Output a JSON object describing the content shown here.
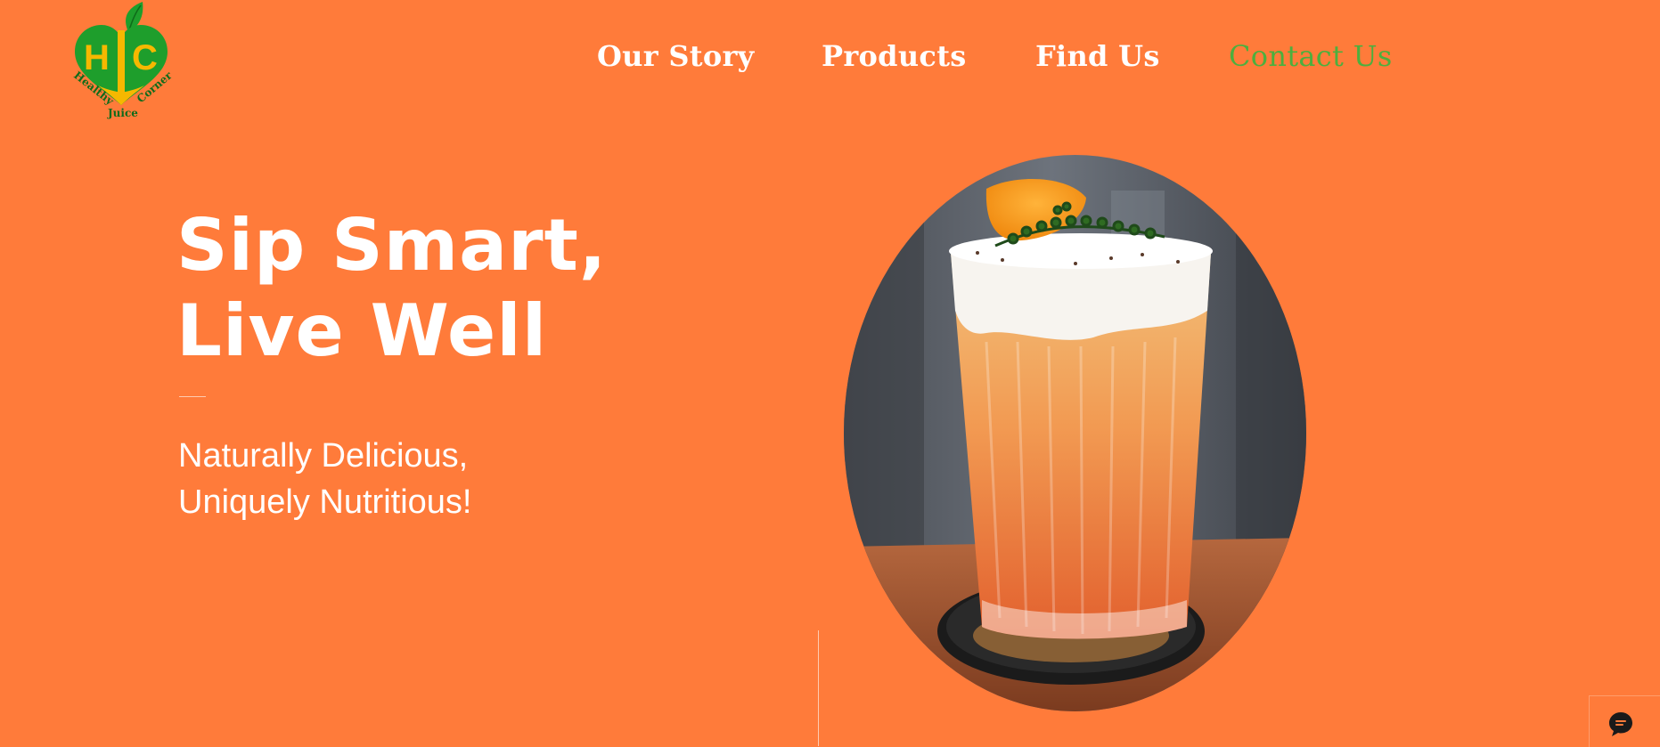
{
  "logo": {
    "letters": [
      "H",
      "C"
    ],
    "ring_text": [
      "Healthy",
      "Juice",
      "Corner"
    ],
    "colors": {
      "green": "#1E9E2C",
      "yellow": "#F6B800",
      "dark_green": "#0F6B1A"
    }
  },
  "nav": {
    "items": [
      {
        "label": "Our Story",
        "active": false
      },
      {
        "label": "Products",
        "active": false
      },
      {
        "label": "Find Us",
        "active": false
      },
      {
        "label": "Contact Us",
        "active": true
      }
    ]
  },
  "hero": {
    "headline_line1": "Sip Smart,",
    "headline_line2": "Live Well",
    "subtitle_line1": "Naturally Delicious,",
    "subtitle_line2": "Uniquely Nutritious!"
  },
  "chat": {
    "icon": "chat-bubble-icon"
  },
  "theme": {
    "background": "#FF7B3A",
    "accent": "#4CAF3E",
    "text": "#FFFFFF"
  }
}
